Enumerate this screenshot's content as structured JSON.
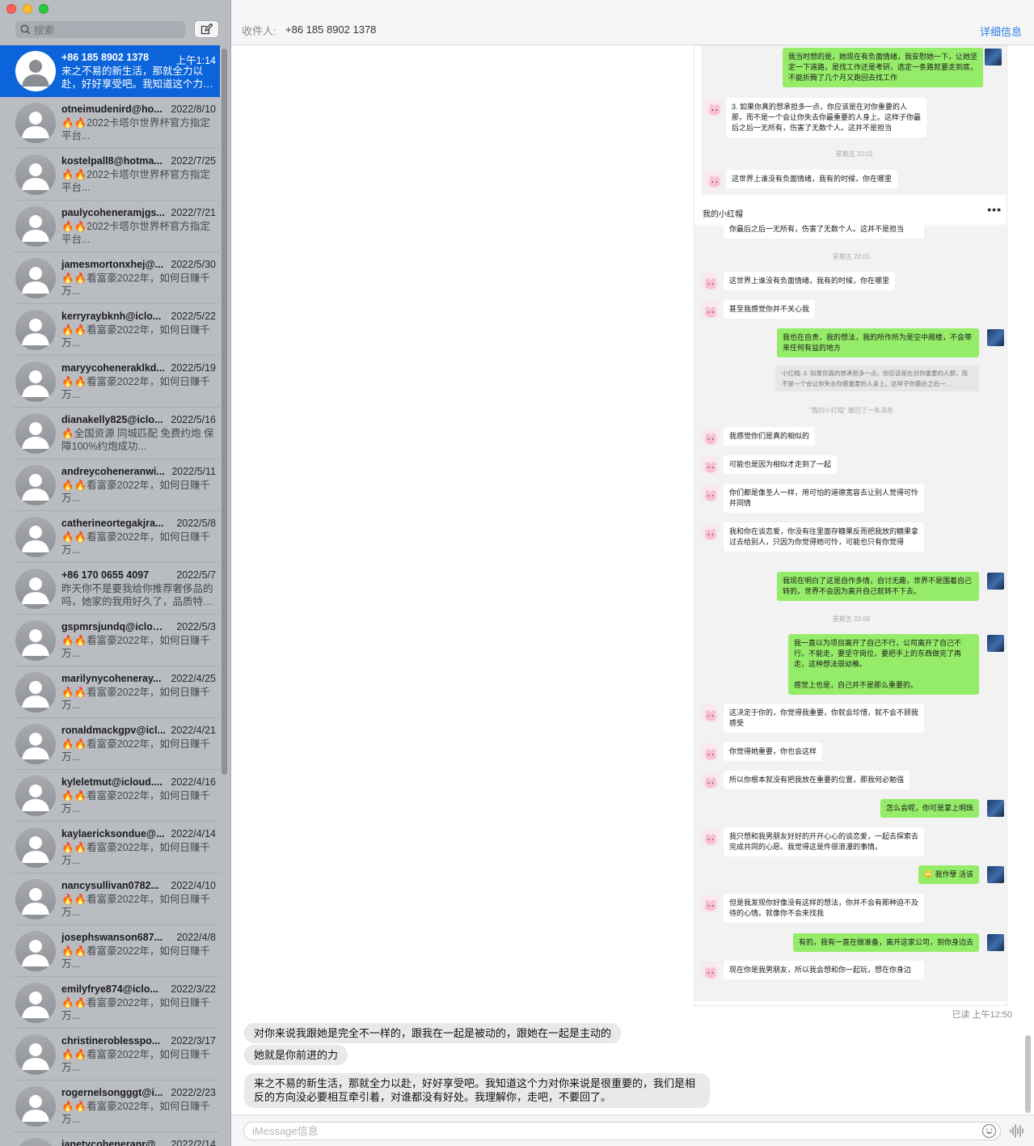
{
  "sidebar": {
    "search_placeholder": "搜索",
    "conversations": [
      {
        "name": "+86 185 8902 1378",
        "time": "上午1:14",
        "preview": "来之不易的新生活，那就全力以赴，好好享受吧。我知道这个力…",
        "selected": true
      },
      {
        "name": "otneimudenird@ho...",
        "time": "2022/8/10",
        "preview": "🔥🔥2022卡塔尔世界杯官方指定平台..."
      },
      {
        "name": "kostelpall8@hotma...",
        "time": "2022/7/25",
        "preview": "🔥🔥2022卡塔尔世界杯官方指定平台..."
      },
      {
        "name": "paulycoheneramjgs...",
        "time": "2022/7/21",
        "preview": "🔥🔥2022卡塔尔世界杯官方指定平台..."
      },
      {
        "name": "jamesmortonxhej@...",
        "time": "2022/5/30",
        "preview": "🔥🔥看富豪2022年，如何日赚千万..."
      },
      {
        "name": "kerryraybknh@iclo...",
        "time": "2022/5/22",
        "preview": "🔥🔥看富豪2022年，如何日赚千万..."
      },
      {
        "name": "maryycoheneraklkd...",
        "time": "2022/5/19",
        "preview": "🔥🔥看富豪2022年，如何日赚千万..."
      },
      {
        "name": "dianakelly825@iclo...",
        "time": "2022/5/16",
        "preview": "🔥全国资源 同城匹配 免费约炮 保障100%约炮成功..."
      },
      {
        "name": "andreycoheneranwi...",
        "time": "2022/5/11",
        "preview": "🔥🔥看富豪2022年，如何日赚千万..."
      },
      {
        "name": "catherineortegakjra...",
        "time": "2022/5/8",
        "preview": "🔥🔥看富豪2022年，如何日赚千万..."
      },
      {
        "name": "+86 170 0655 4097",
        "time": "2022/5/7",
        "preview": "昨天你不是要我给你推荐奢侈品的吗，她家的我用好久了，品质特…"
      },
      {
        "name": "gspmrsjundq@iclou...",
        "time": "2022/5/3",
        "preview": "🔥🔥看富豪2022年，如何日赚千万..."
      },
      {
        "name": "marilynycoheneray...",
        "time": "2022/4/25",
        "preview": "🔥🔥看富豪2022年，如何日赚千万..."
      },
      {
        "name": "ronaldmackgpv@icl...",
        "time": "2022/4/21",
        "preview": "🔥🔥看富豪2022年，如何日赚千万..."
      },
      {
        "name": "kyleletmut@icloud....",
        "time": "2022/4/16",
        "preview": "🔥🔥看富豪2022年，如何日赚千万..."
      },
      {
        "name": "kaylaericksondue@...",
        "time": "2022/4/14",
        "preview": "🔥🔥看富豪2022年，如何日赚千万..."
      },
      {
        "name": "nancysullivan0782...",
        "time": "2022/4/10",
        "preview": "🔥🔥看富豪2022年，如何日赚千万..."
      },
      {
        "name": "josephswanson687...",
        "time": "2022/4/8",
        "preview": "🔥🔥看富豪2022年，如何日赚千万..."
      },
      {
        "name": "emilyfrye874@iclo...",
        "time": "2022/3/22",
        "preview": "🔥🔥看富豪2022年，如何日赚千万..."
      },
      {
        "name": "christineroblesspo...",
        "time": "2022/3/17",
        "preview": "🔥🔥看富豪2022年，如何日赚千万..."
      },
      {
        "name": "rogernelsongggt@i...",
        "time": "2022/2/23",
        "preview": "🔥🔥看富豪2022年，如何日赚千万..."
      },
      {
        "name": "janetycoheneranr@...",
        "time": "2022/2/14",
        "preview": ""
      }
    ]
  },
  "header": {
    "to_label": "收件人:",
    "recipient": "+86 185 8902 1378",
    "details": "详细信息"
  },
  "screenshot": {
    "chat_title": "我的小红帽",
    "more": "•••",
    "top_messages": [
      {
        "side": "r",
        "text": "我当时想的是，她现在有负面情绪，我安慰她一下，让她坚定一下道路，是找工作还是考研，选定一条路就要走到底，不能折腾了几个月又跑回去找工作"
      },
      {
        "side": "l",
        "text": "3. 如果你真的想承担多一点，你应该是在对你重要的人那，而不是一个会让你失去你最重要的人身上。这样子你最后之后一无所有，伤害了无数个人。这并不是担当"
      },
      {
        "side": "ts",
        "text": "星期五 22:01"
      },
      {
        "side": "l",
        "text": "这世界上谁没有负面情绪，我有的时候，你在哪里"
      }
    ],
    "body_cut_line": "你最后之后一无所有，伤害了无数个人。这并不是担当",
    "body_messages": [
      {
        "side": "ts",
        "text": "星期五 22:01"
      },
      {
        "side": "l",
        "text": "这世界上谁没有负面情绪，我有的时候，你在哪里"
      },
      {
        "side": "l",
        "text": "甚至我感觉你并不关心我"
      },
      {
        "side": "r",
        "text": "我也在自责，我的想法，我的所作所为是空中阁楼，不会带来任何有益的地方"
      },
      {
        "side": "quote",
        "text": "小红帽: 3. 如果你真的想承担多一点，你应该是在对你重要的人那，而不是一个会让你失去你最重要的人身上。这样子你最后之后一…"
      },
      {
        "side": "ts",
        "text": "\"我的小红帽\" 撤回了一条消息"
      },
      {
        "side": "l",
        "text": "我感觉你们是真的相似的"
      },
      {
        "side": "l",
        "text": "可能也是因为相似才走到了一起"
      },
      {
        "side": "l",
        "text": "你们都是像圣人一样，用可怕的道德宽容去让别人觉得可怜并同情"
      },
      {
        "side": "l",
        "text": "我和你在谈恋爱，你没有往里面存糖果反而把我放的糖果拿过去给别人，只因为你觉得她可怜，可能也只有你觉得"
      },
      {
        "side": "r",
        "text": "我现在明白了这是自作多情，自讨无趣，世界不是围着自己转的，世界不会因为离开自己就转不下去。"
      },
      {
        "side": "ts",
        "text": "星期五 22:09"
      },
      {
        "side": "r",
        "text": "我一直以为项目离开了自己不行，公司离开了自己不行。不能走，要坚守岗位，要把手上的东西做完了再走，这种想法很幼稚。\n\n感觉上也是，自己并不是那么重要的。"
      },
      {
        "side": "l",
        "text": "这决定于你的，你觉得我重要，你就会珍惜，就不会不顾我感受"
      },
      {
        "side": "l",
        "text": "你觉得她重要，你也会这样"
      },
      {
        "side": "l",
        "text": "所以你根本就没有把我放在重要的位置，那我何必勉强"
      },
      {
        "side": "r",
        "text": "怎么会呢，你可是掌上明珠"
      },
      {
        "side": "l",
        "text": "我只想和我男朋友好好的开开心心的谈恋爱，一起去探索去完成共同的心愿。我觉得这是件很浪漫的事情。"
      },
      {
        "side": "r",
        "text": "🙄 我作孽 活该"
      },
      {
        "side": "l",
        "text": "但是我发现你好像没有这样的想法，你并不会有那种迫不及待的心情。就像你不会来找我"
      },
      {
        "side": "r",
        "text": "有的，我有一直在做准备，离开这家公司，到你身边去"
      },
      {
        "side": "l",
        "text": "现在你是我男朋友，所以我会想和你一起玩，想在你身边"
      }
    ]
  },
  "thread": {
    "read_status": "已读 上午12:50",
    "messages": [
      "对你来说我跟她是完全不一样的，跟我在一起是被动的，跟她在一起是主动的",
      "她就是你前进的力",
      "来之不易的新生活，那就全力以赴，好好享受吧。我知道这个力对你来说是很重要的，我们是相反的方向没必要相互牵引着，对谁都没有好处。我理解你，走吧，不要回了。"
    ]
  },
  "composer": {
    "placeholder": "iMessage信息"
  },
  "icons": [
    "search-icon",
    "compose-icon",
    "person-icon",
    "emoji-icon",
    "audio-wave-icon",
    "more-icon"
  ]
}
